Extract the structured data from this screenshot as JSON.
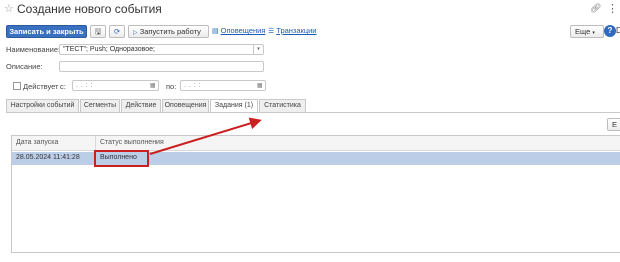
{
  "window": {
    "title": "Создание нового события",
    "favorite_icon": "star-icon",
    "link_icon": "link-icon",
    "menu_icon": "kebab-icon"
  },
  "toolbar": {
    "save_close_label": "Записать и закрыть",
    "save_icon": "save-icon",
    "refresh_icon": "refresh-icon",
    "run_label": "Запустить работу",
    "alerts_label": "Оповещения",
    "transactions_label": "Транзакции",
    "more_label": "Еще",
    "help_label": "?",
    "cut_label": "D"
  },
  "form": {
    "name_label": "Наименование:",
    "name_value": "\"ТЕСТ\"; Push; Одноразовое;",
    "description_label": "Описание:",
    "description_value": "",
    "active_label": "Действует",
    "active_checked": false,
    "from_label": "с:",
    "from_value": ". .   : :",
    "to_label": "по:",
    "to_value": ". .   : :"
  },
  "tabs": [
    {
      "label": "Настройки событий",
      "active": false
    },
    {
      "label": "Сегменты",
      "active": false
    },
    {
      "label": "Действие",
      "active": false
    },
    {
      "label": "Оповещения",
      "active": false
    },
    {
      "label": "Задания (1)",
      "active": true
    },
    {
      "label": "Статистика",
      "active": false
    }
  ],
  "panel": {
    "cut_button_label": "Е"
  },
  "grid": {
    "columns": [
      "Дата запуска",
      "Статус выполнения"
    ],
    "rows": [
      {
        "date": "28.05.2024 11:41:28",
        "status": "Выполнено",
        "selected": true
      }
    ]
  },
  "colors": {
    "primary": "#3a70c0",
    "selection": "#bccde8",
    "annotation": "#cc1f1f",
    "link": "#1a5fb4"
  }
}
